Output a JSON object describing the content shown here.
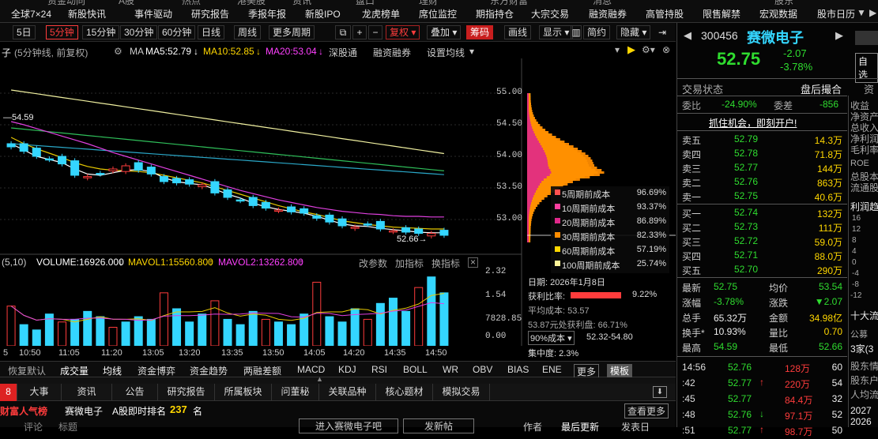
{
  "menubar": {
    "items": [
      "全球7×24",
      "新股快讯",
      "事件驱动",
      "研究报告",
      "季报年报",
      "新股IPO",
      "龙虎榜单",
      "席位监控",
      "期指持仓",
      "大宗交易",
      "融资融券",
      "高管持股",
      "限售解禁",
      "宏观数据",
      "股市日历"
    ],
    "partial_top": [
      "资金动向",
      "A股",
      "热点",
      "港美股",
      "资讯",
      "盘口",
      "理财",
      "东方财富",
      "消息",
      "股东"
    ],
    "more_arrow": "▼",
    "search_arrow": "▶"
  },
  "toolbar": {
    "periods": [
      "5日",
      "5分钟",
      "15分钟",
      "30分钟",
      "60分钟",
      "日线",
      "周线",
      "更多周期"
    ],
    "active_period": "5分钟",
    "adjust": "复权",
    "overlay": "叠加",
    "chips": "筹码",
    "draw": "画线",
    "display": "显示",
    "simple": "简约",
    "hide": "隐藏"
  },
  "infobar": {
    "name_cut": "子",
    "mode": "(5分钟线, 前复权)",
    "ma_label": "MA",
    "ma5": "MA5:52.79",
    "ma10": "MA10:52.85",
    "ma20": "MA20:53.04",
    "links": [
      "深股通",
      "融资融券",
      "设置均线"
    ]
  },
  "chart": {
    "high_marker": "54.59",
    "low_marker": "52.66",
    "price_axis": [
      "55.00",
      "54.50",
      "54.00",
      "53.50",
      "53.00"
    ],
    "vol_axis": [
      "2.32",
      "1.54",
      "7828.85",
      "0.00"
    ],
    "time_axis": [
      "10:50",
      "11:05",
      "11:20",
      "13:05",
      "13:20",
      "13:35",
      "13:50",
      "14:05",
      "14:20",
      "14:35",
      "14:50"
    ]
  },
  "chart_data": {
    "type": "candlestick",
    "x_time": [
      "10:35",
      "10:40",
      "10:45",
      "10:50",
      "10:55",
      "11:00",
      "11:05",
      "11:10",
      "11:15",
      "11:20",
      "11:25",
      "11:30",
      "13:05",
      "13:10",
      "13:15",
      "13:20",
      "13:25",
      "13:30",
      "13:35",
      "13:40",
      "13:45",
      "13:50",
      "13:55",
      "14:00",
      "14:05",
      "14:10",
      "14:15",
      "14:20",
      "14:25",
      "14:30",
      "14:35",
      "14:40",
      "14:45",
      "14:50",
      "14:55"
    ],
    "close": [
      54.15,
      54.08,
      54.0,
      53.95,
      53.88,
      53.7,
      53.68,
      53.72,
      53.8,
      53.85,
      53.78,
      53.72,
      53.6,
      53.58,
      53.56,
      53.55,
      53.42,
      53.35,
      53.3,
      53.22,
      53.18,
      53.15,
      53.12,
      53.1,
      53.02,
      52.96,
      52.9,
      52.88,
      52.92,
      52.85,
      52.82,
      52.8,
      52.78,
      52.78,
      52.75
    ],
    "ma5": [
      54.2,
      54.1,
      54.0,
      53.95,
      53.9,
      53.8,
      53.72,
      53.7,
      53.74,
      53.78,
      53.79,
      53.76,
      53.66,
      53.6,
      53.57,
      53.55,
      53.48,
      53.4,
      53.34,
      53.26,
      53.2,
      53.16,
      53.13,
      53.1,
      53.05,
      52.99,
      52.93,
      52.9,
      52.89,
      52.86,
      52.84,
      52.82,
      52.8,
      52.79,
      52.79
    ],
    "ma10": [
      54.3,
      54.2,
      54.12,
      54.05,
      53.98,
      53.9,
      53.84,
      53.8,
      53.78,
      53.77,
      53.76,
      53.74,
      53.7,
      53.66,
      53.62,
      53.58,
      53.52,
      53.46,
      53.4,
      53.34,
      53.28,
      53.22,
      53.17,
      53.12,
      53.08,
      53.03,
      52.98,
      52.95,
      52.92,
      52.9,
      52.88,
      52.87,
      52.86,
      52.85,
      52.85
    ],
    "ma20": [
      54.55,
      54.5,
      54.44,
      54.38,
      54.32,
      54.26,
      54.2,
      54.13,
      54.06,
      54.0,
      53.94,
      53.88,
      53.82,
      53.76,
      53.7,
      53.64,
      53.58,
      53.52,
      53.46,
      53.41,
      53.36,
      53.31,
      53.27,
      53.23,
      53.19,
      53.16,
      53.13,
      53.11,
      53.09,
      53.08,
      53.06,
      53.05,
      53.05,
      53.04,
      53.04
    ],
    "volume": [
      1.5,
      0.8,
      0.6,
      1.2,
      0.9,
      1.0,
      1.3,
      1.1,
      0.7,
      0.9,
      1.1,
      1.0,
      2.0,
      1.4,
      0.9,
      1.2,
      1.7,
      1.0,
      0.8,
      1.3,
      1.0,
      0.9,
      0.8,
      1.2,
      2.4,
      1.1,
      0.9,
      1.4,
      1.0,
      1.6,
      1.8,
      1.3,
      2.2,
      2.6,
      2.0
    ],
    "ylim": [
      52.5,
      55.2
    ],
    "vol_ylim": [
      0,
      2.8
    ],
    "volume_labels": {
      "volume": "VOLUME:16926.000",
      "mavol1": "MAVOL1:15560.800",
      "mavol2": "MAVOL2:13262.800",
      "params": "(5,10)"
    }
  },
  "chip_legend": [
    {
      "label": "5周期前成本",
      "value": "96.69%",
      "color": "#ff5050"
    },
    {
      "label": "10周期前成本",
      "value": "93.37%",
      "color": "#ff3fa0"
    },
    {
      "label": "20周期前成本",
      "value": "86.89%",
      "color": "#e0288a"
    },
    {
      "label": "30周期前成本",
      "value": "82.33%",
      "color": "#ff8c00"
    },
    {
      "label": "60周期前成本",
      "value": "57.19%",
      "color": "#ffd700"
    },
    {
      "label": "100周期前成本",
      "value": "25.74%",
      "color": "#fff59a"
    }
  ],
  "chip_info": {
    "date": "日期: 2026年1月8日",
    "profit_label": "获利比率:",
    "profit_value": "9.22%",
    "avg_cost": "平均成本: 53.57",
    "profit_at": "53.87元处获利盘: 66.71%",
    "cost_select": "90%成本",
    "cost_range": "52.32-54.80",
    "concentration": "集中度: 2.3%"
  },
  "vol_links": [
    "改参数",
    "加指标",
    "换指标"
  ],
  "indicator_tabs": [
    "恢复默认",
    "成交量",
    "均线",
    "资金博弈",
    "资金趋势",
    "两融差额",
    "MACD",
    "KDJ",
    "RSI",
    "BOLL",
    "WR",
    "OBV",
    "BIAS",
    "ENE",
    "更多",
    "模板"
  ],
  "news_tabs": [
    "大事",
    "资讯",
    "公告",
    "研究报告",
    "所属板块",
    "问董秘",
    "关联品种",
    "核心题材",
    "模拟交易"
  ],
  "bottom": {
    "popularity": "财富人气榜",
    "stock_name": "赛微电子",
    "rank_label": "A股即时排名",
    "rank_value": "237",
    "rank_unit": "名",
    "more_btn": "查看更多",
    "cut_labels": [
      "评论",
      "标题",
      "进入赛微电子吧",
      "发新帖",
      "作者",
      "最后更新",
      "发表日"
    ]
  },
  "right": {
    "code": "300456",
    "name": "赛微电子",
    "price": "52.75",
    "change": "-2.07",
    "pct": "-3.78%",
    "self_select": "自选",
    "status_label": "交易状态",
    "status_value": "盘后撮合",
    "weibi_label": "委比",
    "weibi_value": "-24.90%",
    "weicha_label": "委差",
    "weicha_value": "-856",
    "promo": "抓住机会，即刻开户!",
    "asks": [
      {
        "label": "卖五",
        "price": "52.79",
        "vol": "14.3万"
      },
      {
        "label": "卖四",
        "price": "52.78",
        "vol": "71.8万"
      },
      {
        "label": "卖三",
        "price": "52.77",
        "vol": "144万"
      },
      {
        "label": "卖二",
        "price": "52.76",
        "vol": "863万"
      },
      {
        "label": "卖一",
        "price": "52.75",
        "vol": "40.6万"
      }
    ],
    "bids": [
      {
        "label": "买一",
        "price": "52.74",
        "vol": "132万"
      },
      {
        "label": "买二",
        "price": "52.73",
        "vol": "111万"
      },
      {
        "label": "买三",
        "price": "52.72",
        "vol": "59.0万"
      },
      {
        "label": "买四",
        "price": "52.71",
        "vol": "88.0万"
      },
      {
        "label": "买五",
        "price": "52.70",
        "vol": "290万"
      }
    ],
    "stats": [
      {
        "l1": "最新",
        "v1": "52.75",
        "c1": "green",
        "l2": "均价",
        "v2": "53.54",
        "c2": "green"
      },
      {
        "l1": "涨幅",
        "v1": "-3.78%",
        "c1": "green",
        "l2": "涨跌",
        "v2": "▼2.07",
        "c2": "green"
      },
      {
        "l1": "总手",
        "v1": "65.32万",
        "c1": "white",
        "l2": "金额",
        "v2": "34.98亿",
        "c2": "yellow"
      },
      {
        "l1": "换手*",
        "v1": "10.93%",
        "c1": "white",
        "l2": "量比",
        "v2": "0.70",
        "c2": "yellow"
      },
      {
        "l1": "最高",
        "v1": "54.59",
        "c1": "green",
        "l2": "最低",
        "v2": "52.66",
        "c2": "green"
      }
    ],
    "ticks": [
      {
        "t": "14:56",
        "p": "52.76",
        "a": "",
        "v": "128万",
        "n": "60"
      },
      {
        "t": ":42",
        "p": "52.77",
        "a": "↑",
        "v": "220万",
        "n": "54"
      },
      {
        "t": ":45",
        "p": "52.77",
        "a": "",
        "v": "84.4万",
        "n": "32"
      },
      {
        "t": ":48",
        "p": "52.76",
        "a": "↓",
        "v": "97.1万",
        "n": "52"
      },
      {
        "t": ":51",
        "p": "52.77",
        "a": "↑",
        "v": "98.7万",
        "n": "50"
      }
    ],
    "far_labels": [
      "资",
      "收益",
      "净资产",
      "总收入",
      "净利润",
      "毛利率",
      "ROE",
      "总股本",
      "流通股",
      "利润趋",
      "十大流",
      "公募",
      "3家(3",
      "股东情",
      "股东户",
      "人均流",
      "2027",
      "2026"
    ],
    "far_ticks": [
      "16",
      "12",
      "8",
      "4",
      "0",
      "-4",
      "-8",
      "-12"
    ]
  }
}
